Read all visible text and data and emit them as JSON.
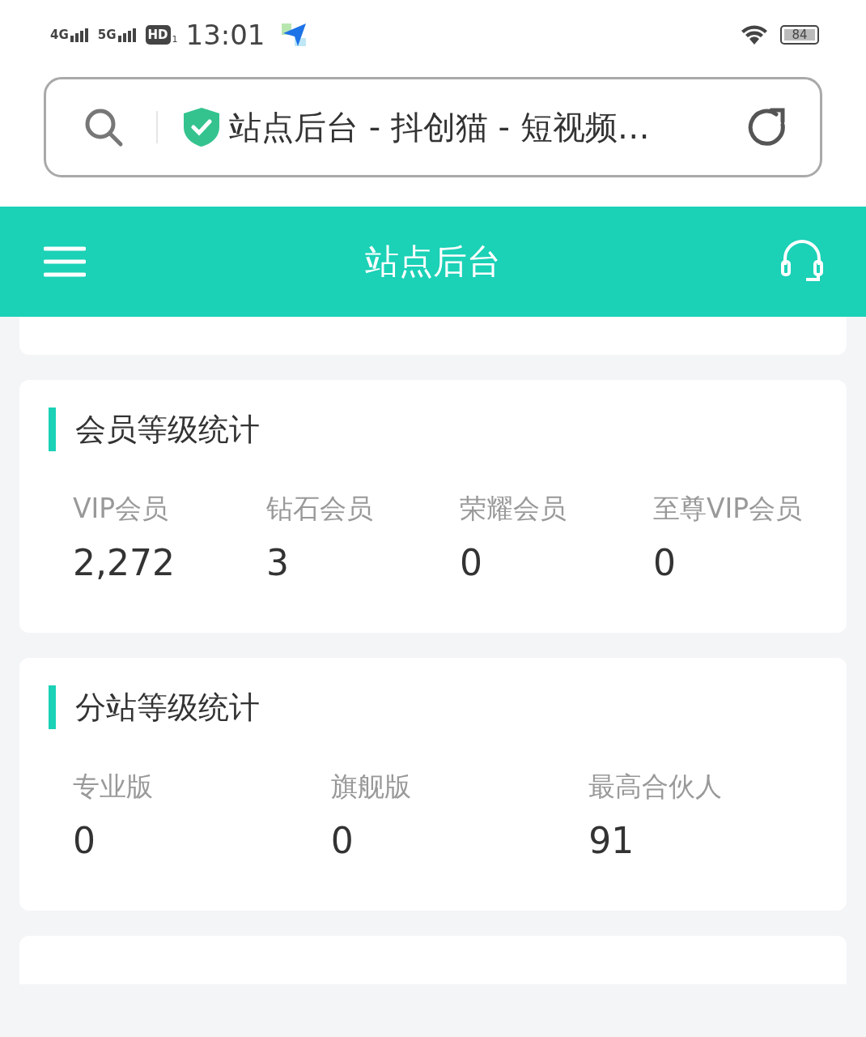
{
  "status_bar": {
    "network_1": "4G",
    "network_2": "5G",
    "hd_badge": "HD",
    "sim": "1",
    "time": "13:01",
    "battery": "84"
  },
  "browser_bar": {
    "title": "站点后台 - 抖创猫 - 短视频…"
  },
  "header": {
    "title": "站点后台"
  },
  "sections": [
    {
      "title": "会员等级统计",
      "stats": [
        {
          "label": "VIP会员",
          "value": "2,272"
        },
        {
          "label": "钻石会员",
          "value": "3"
        },
        {
          "label": "荣耀会员",
          "value": "0"
        },
        {
          "label": "至尊VIP会员",
          "value": "0"
        }
      ]
    },
    {
      "title": "分站等级统计",
      "stats": [
        {
          "label": "专业版",
          "value": "0"
        },
        {
          "label": "旗舰版",
          "value": "0"
        },
        {
          "label": "最高合伙人",
          "value": "91"
        }
      ]
    }
  ]
}
